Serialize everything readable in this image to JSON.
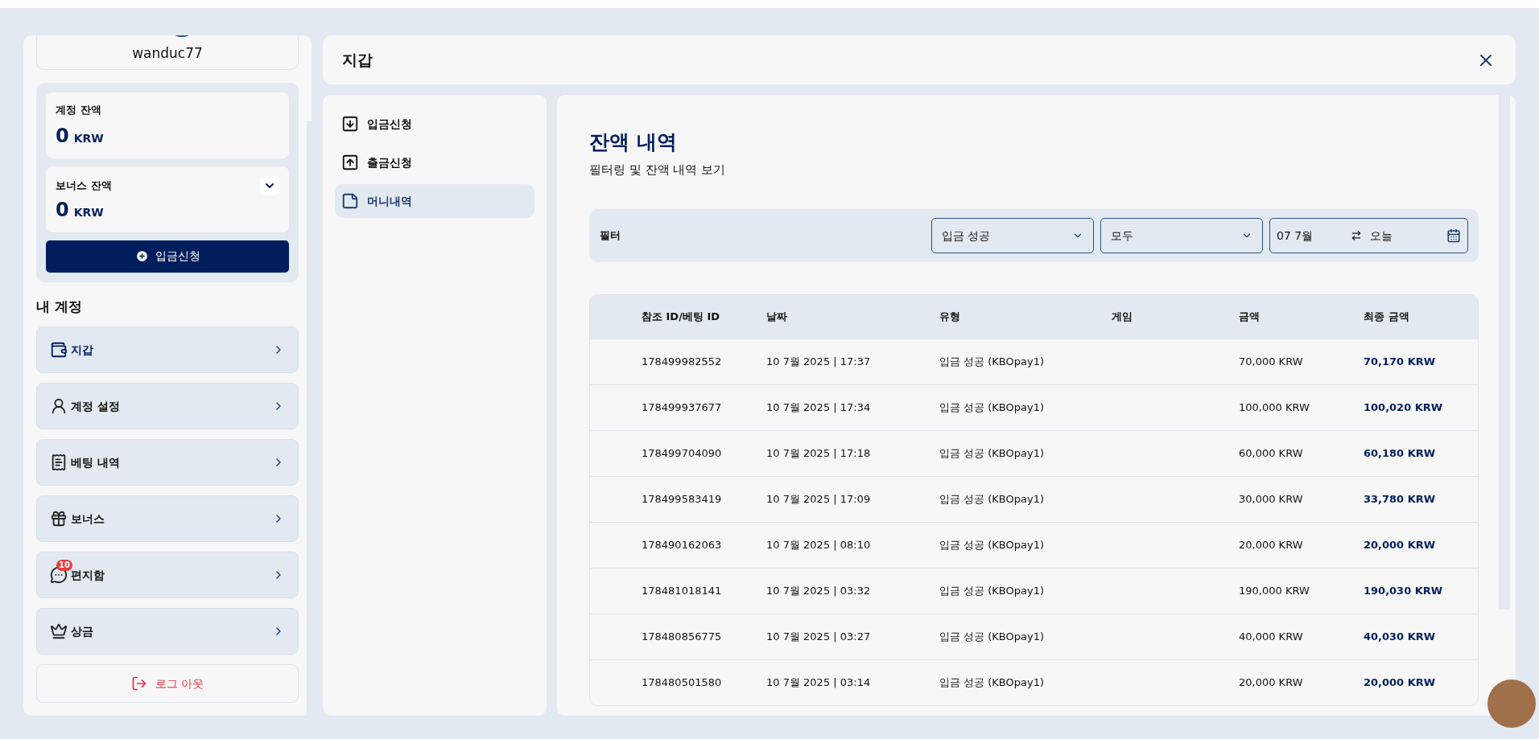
{
  "profile": {
    "username": "wanduc77"
  },
  "balances": [
    {
      "label": "계정 잔액",
      "amount": "0",
      "currency": "KRW",
      "expandable": false
    },
    {
      "label": "보너스 잔액",
      "amount": "0",
      "currency": "KRW",
      "expandable": true
    }
  ],
  "deposit_button": "입금신청",
  "account_section": {
    "title": "내 계정",
    "items": [
      {
        "label": "지갑",
        "selected": true
      },
      {
        "label": "계정 설정",
        "selected": false
      },
      {
        "label": "베팅 내역",
        "selected": false
      },
      {
        "label": "보너스",
        "selected": false
      },
      {
        "label": "편지함",
        "selected": false,
        "badge": "10"
      },
      {
        "label": "상금",
        "selected": false
      }
    ]
  },
  "logout": "로그 아웃",
  "header": {
    "title": "지갑"
  },
  "wallet_nav": [
    {
      "label": "입금신청",
      "selected": false
    },
    {
      "label": "출금신청",
      "selected": false
    },
    {
      "label": "머니내역",
      "selected": true
    }
  ],
  "content": {
    "title": "잔액 내역",
    "subtitle": "필터링 및 잔액 내역 보기",
    "filter": {
      "label": "필터",
      "type_select": "입금 성공",
      "status_select": "모두",
      "date_from": "07 7월",
      "date_to": "오늘"
    },
    "table": {
      "columns": [
        "참조 ID/베팅 ID",
        "날짜",
        "유형",
        "게임",
        "금액",
        "최종 금액"
      ],
      "rows": [
        [
          "178499982552",
          "10 7월 2025 | 17:37",
          "입금 성공 (KBOpay1)",
          "",
          "70,000 KRW",
          "70,170 KRW"
        ],
        [
          "178499937677",
          "10 7월 2025 | 17:34",
          "입금 성공 (KBOpay1)",
          "",
          "100,000 KRW",
          "100,020 KRW"
        ],
        [
          "178499704090",
          "10 7월 2025 | 17:18",
          "입금 성공 (KBOpay1)",
          "",
          "60,000 KRW",
          "60,180 KRW"
        ],
        [
          "178499583419",
          "10 7월 2025 | 17:09",
          "입금 성공 (KBOpay1)",
          "",
          "30,000 KRW",
          "33,780 KRW"
        ],
        [
          "178490162063",
          "10 7월 2025 | 08:10",
          "입금 성공 (KBOpay1)",
          "",
          "20,000 KRW",
          "20,000 KRW"
        ],
        [
          "178481018141",
          "10 7월 2025 | 03:32",
          "입금 성공 (KBOpay1)",
          "",
          "190,000 KRW",
          "190,030 KRW"
        ],
        [
          "178480856775",
          "10 7월 2025 | 03:27",
          "입금 성공 (KBOpay1)",
          "",
          "40,000 KRW",
          "40,030 KRW"
        ],
        [
          "178480501580",
          "10 7월 2025 | 03:14",
          "입금 성공 (KBOpay1)",
          "",
          "20,000 KRW",
          "20,000 KRW"
        ]
      ]
    }
  }
}
